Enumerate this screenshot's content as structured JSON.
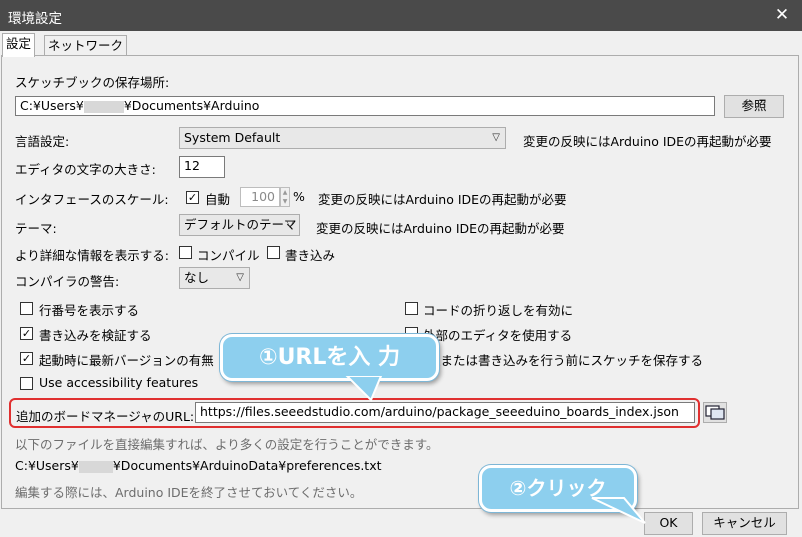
{
  "window": {
    "title": "環境設定",
    "close_glyph": "✕"
  },
  "tabs": [
    {
      "label": "設定"
    },
    {
      "label": "ネットワーク"
    }
  ],
  "sketchbook": {
    "label": "スケッチブックの保存場所:",
    "path_prefix": "C:¥Users¥",
    "path_suffix": "¥Documents¥Arduino",
    "browse": "参照"
  },
  "language": {
    "label": "言語設定:",
    "value": "System Default",
    "note": "変更の反映にはArduino IDEの再起動が必要"
  },
  "font_size": {
    "label": "エディタの文字の大きさ:",
    "value": "12"
  },
  "scale": {
    "label": "インタフェースのスケール:",
    "auto_label": "自動",
    "value": "100",
    "unit": "%",
    "note": "変更の反映にはArduino IDEの再起動が必要"
  },
  "theme": {
    "label": "テーマ:",
    "value": "デフォルトのテーマ",
    "note": "変更の反映にはArduino IDEの再起動が必要"
  },
  "verbose": {
    "label": "より詳細な情報を表示する:",
    "compile": "コンパイル",
    "upload": "書き込み"
  },
  "warnings": {
    "label": "コンパイラの警告:",
    "value": "なし"
  },
  "options": {
    "line_numbers": "行番号を表示する",
    "code_folding": "コードの折り返しを有効に",
    "verify_upload": "書き込みを検証する",
    "external_editor": "外部のエディタを使用する",
    "check_updates": "起動時に最新バージョンの有無",
    "save_on_verify": "証または書き込みを行う前にスケッチを保存する",
    "accessibility": "Use accessibility features"
  },
  "boards": {
    "label": "追加のボードマネージャのURL:",
    "url": "https://files.seeedstudio.com/arduino/package_seeeduino_boards_index.json"
  },
  "info": {
    "edit_note": "以下のファイルを直接編集すれば、より多くの設定を行うことができます。",
    "pref_prefix": "C:¥Users¥",
    "pref_suffix": "¥Documents¥ArduinoData¥preferences.txt",
    "close_note": "編集する際には、Arduino IDEを終了させておいてください。"
  },
  "buttons": {
    "ok": "OK",
    "cancel": "キャンセル"
  },
  "callouts": {
    "step1": "①URLを入 力",
    "step2": "②クリック"
  },
  "colors": {
    "titlebar": "#4a4a4a",
    "callout": "#8dcfee",
    "highlight": "#e03030"
  }
}
